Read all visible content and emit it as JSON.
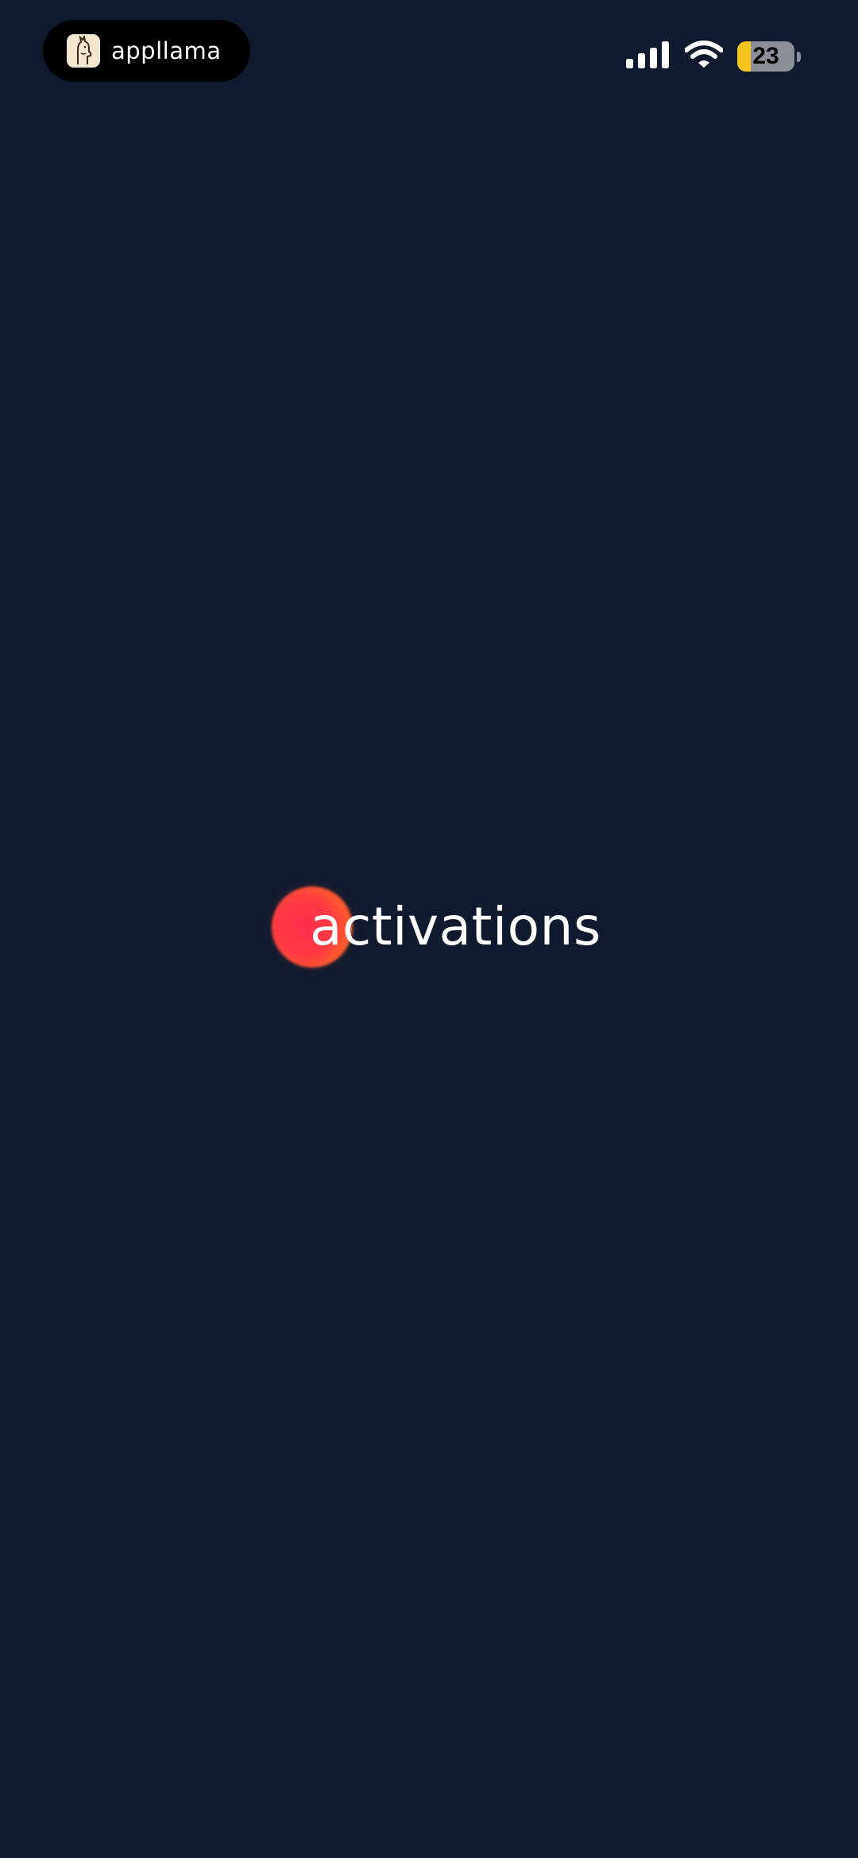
{
  "status_bar": {
    "recording_app_name": "appllama",
    "battery_level": "23",
    "battery_fraction": 0.23,
    "signal_icon": "cellular-signal-icon",
    "wifi_icon": "wifi-icon",
    "battery_color": "#f4c51c"
  },
  "splash": {
    "brand_name": "activations",
    "brand_mark_icon": "gradient-orb-icon",
    "background_color": "#101a2f"
  }
}
